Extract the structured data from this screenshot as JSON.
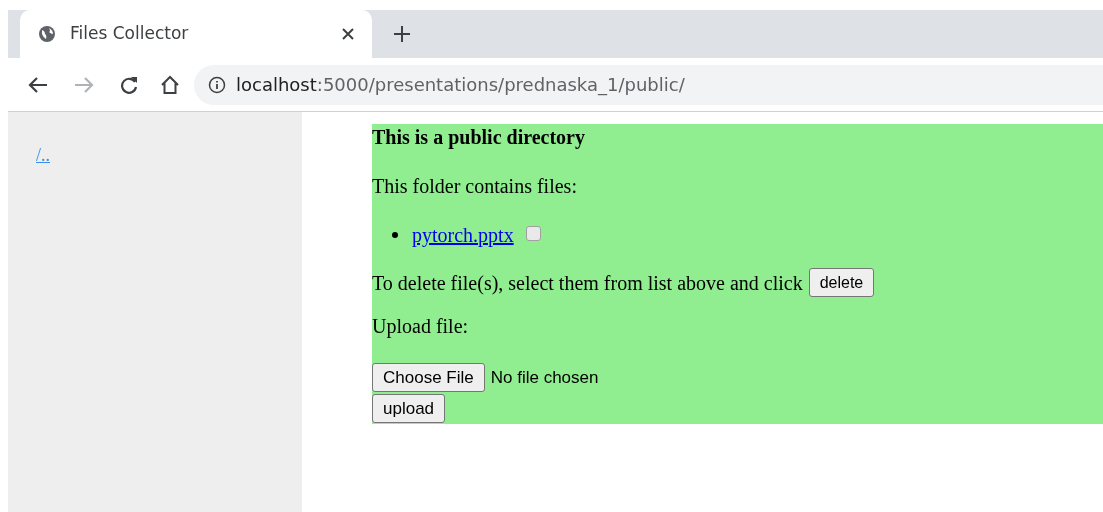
{
  "browser": {
    "tab": {
      "title": "Files Collector",
      "selected": true
    },
    "url": {
      "host": "localhost",
      "path": ":5000/presentations/prednaska_1/public/"
    }
  },
  "sidebar": {
    "links": [
      "/.."
    ]
  },
  "content": {
    "heading": "This is a public directory",
    "files_label": "This folder contains files:",
    "files": [
      {
        "name": "pytorch.pptx",
        "checked": false
      }
    ],
    "delete_text": "To delete file(s), select them from list above and click",
    "delete_button": "delete",
    "upload_label": "Upload file:",
    "choose_button": "Choose File",
    "file_status": "No file chosen",
    "upload_button": "upload"
  }
}
